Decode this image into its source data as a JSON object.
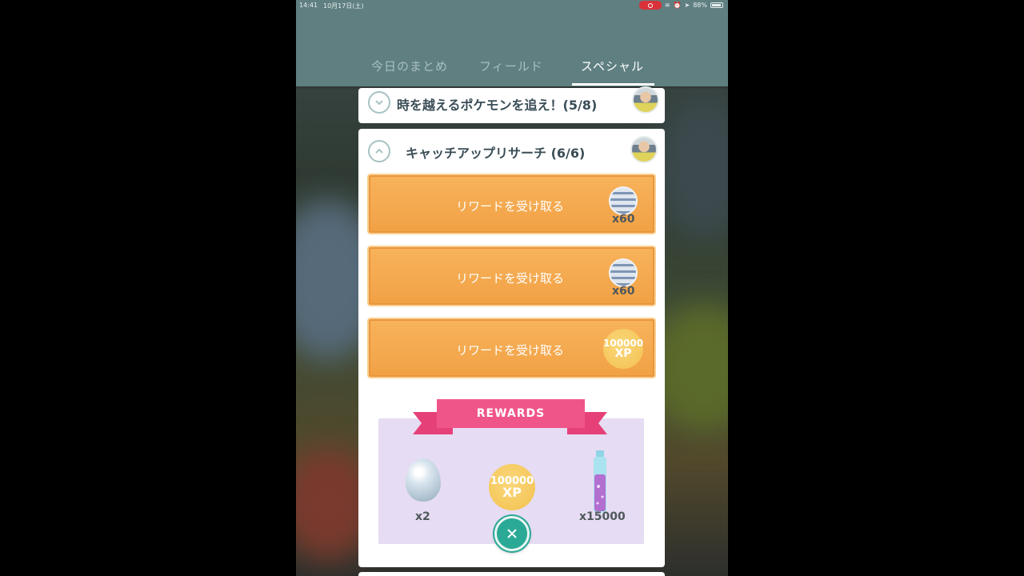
{
  "status_bar": {
    "time": "14:41",
    "date": "10月17日(土)",
    "battery": "88%"
  },
  "tabs": [
    {
      "label": "今日のまとめ",
      "active": false
    },
    {
      "label": "フィールド",
      "active": false
    },
    {
      "label": "スペシャル",
      "active": true
    }
  ],
  "collapsed_card": {
    "title": "時を越えるポケモンを追え！(5/8)"
  },
  "expanded_card": {
    "title": "キャッチアップリサーチ (6/6)",
    "tasks": [
      {
        "label": "リワードを受け取る",
        "reward_icon": "great-ball-icon",
        "reward_count": "x60"
      },
      {
        "label": "リワードを受け取る",
        "reward_icon": "great-ball-icon",
        "reward_count": "x60"
      },
      {
        "label": "リワードを受け取る",
        "reward_icon": "xp-icon",
        "reward_amount": "100000",
        "reward_unit": "XP"
      }
    ],
    "rewards": {
      "banner": "REWARDS",
      "items": [
        {
          "icon": "egg-icon",
          "count": "x2"
        },
        {
          "icon": "xp-icon",
          "amount": "100000",
          "unit": "XP"
        },
        {
          "icon": "stardust-bottle-icon",
          "count": "x15000"
        }
      ]
    }
  },
  "colors": {
    "header": "#5f7f80",
    "task_button": "#f4a74c",
    "ribbon": "#f0558a",
    "rewards_bg": "#e6dcf3",
    "close_button": "#2aa996"
  }
}
